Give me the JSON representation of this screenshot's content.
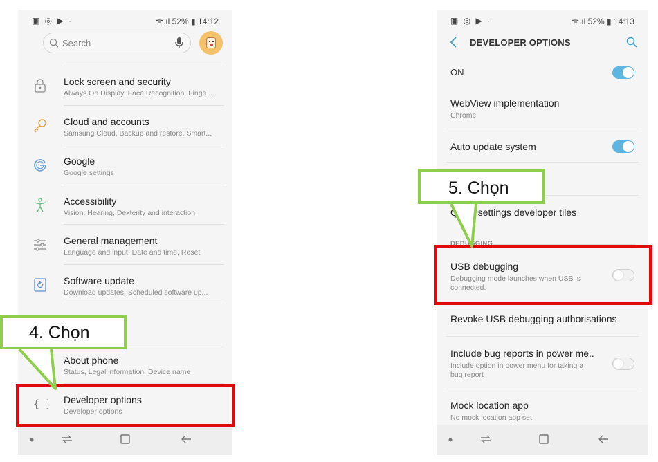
{
  "left_phone": {
    "status": {
      "icons": "▣ ◎ ▶ ·",
      "battery": "52%",
      "time": "14:12"
    },
    "search_placeholder": "Search",
    "items": [
      {
        "title": "Lock screen and security",
        "subtitle": "Always On Display, Face Recognition, Finge...",
        "icon": "lock-icon"
      },
      {
        "title": "Cloud and accounts",
        "subtitle": "Samsung Cloud, Backup and restore, Smart...",
        "icon": "key-icon"
      },
      {
        "title": "Google",
        "subtitle": "Google settings",
        "icon": "google-icon"
      },
      {
        "title": "Accessibility",
        "subtitle": "Vision, Hearing, Dexterity and interaction",
        "icon": "accessibility-icon"
      },
      {
        "title": "General management",
        "subtitle": "Language and input, Date and time, Reset",
        "icon": "sliders-icon"
      },
      {
        "title": "Software update",
        "subtitle": "Download updates, Scheduled software up...",
        "icon": "update-icon"
      },
      {
        "title": "",
        "subtitle": "",
        "icon": ""
      },
      {
        "title": "About phone",
        "subtitle": "Status, Legal information, Device name",
        "icon": "info-icon"
      },
      {
        "title": "Developer options",
        "subtitle": "Developer options",
        "icon": "braces-icon"
      }
    ]
  },
  "right_phone": {
    "status": {
      "icons": "▣ ◎ ▶ ·",
      "battery": "52%",
      "time": "14:13"
    },
    "header_title": "DEVELOPER OPTIONS",
    "master_label": "ON",
    "master_on": true,
    "items_top": [
      {
        "title": "WebView implementation",
        "subtitle": "Chrome"
      },
      {
        "title": "Auto update system",
        "subtitle": "",
        "toggle": "on"
      },
      {
        "title": "",
        "subtitle": ""
      },
      {
        "title": "Quick settings developer tiles",
        "subtitle": ""
      }
    ],
    "section_label": "DEBUGGING",
    "items_debug": [
      {
        "title": "USB debugging",
        "subtitle": "Debugging mode launches when USB is connected.",
        "toggle": "off"
      },
      {
        "title": "Revoke USB debugging authorisations",
        "subtitle": ""
      },
      {
        "title": "Include bug reports in power me..",
        "subtitle": "Include option in power menu for taking a bug report",
        "toggle": "off"
      },
      {
        "title": "Mock location app",
        "subtitle": "No mock location app set"
      }
    ]
  },
  "callouts": {
    "step4": "4. Chọn",
    "step5": "5. Chọn"
  },
  "colors": {
    "highlight": "#e10a0a",
    "callout_border": "#8dce4a",
    "toggle_on": "#5db5e0"
  }
}
